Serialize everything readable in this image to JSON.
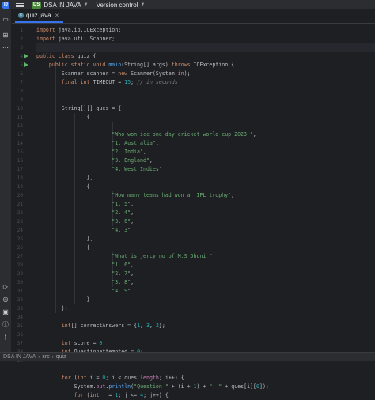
{
  "titlebar": {
    "project_badge": "DS",
    "project_name": "DSA IN JAVA",
    "vcs": "Version control"
  },
  "tab": {
    "label": "quiz.java"
  },
  "statusbar": {
    "breadcrumb": [
      "DSA IN JAVA",
      "src",
      "quiz"
    ]
  },
  "line_numbers": [
    "1",
    "2",
    "3",
    "4",
    "5",
    "6",
    "7",
    "8",
    "9",
    "10",
    "11",
    "12",
    "13",
    "14",
    "15",
    "16",
    "17",
    "18",
    "19",
    "20",
    "21",
    "22",
    "23",
    "24",
    "25",
    "26",
    "27",
    "28",
    "29",
    "30",
    "31",
    "32",
    "33",
    "34",
    "35",
    "36",
    "37",
    "38",
    "39"
  ],
  "colors": {
    "keyword": "#cf8e6d",
    "string": "#6aab73",
    "number": "#2aacb8",
    "comment": "#7a7e85",
    "method": "#56a8f5",
    "field": "#c77dbb",
    "text": "#bcbec4"
  },
  "code_lines": [
    [
      {
        "t": "import ",
        "c": "kw"
      },
      {
        "t": "java.io.IOException;"
      }
    ],
    [
      {
        "t": "import ",
        "c": "kw"
      },
      {
        "t": "java.util.Scanner;"
      }
    ],
    [],
    [
      {
        "t": "public class ",
        "c": "kw"
      },
      {
        "t": "quiz {"
      }
    ],
    [
      {
        "t": "    public static void ",
        "c": "kw"
      },
      {
        "t": "main",
        "c": "fn"
      },
      {
        "t": "(String[] args) "
      },
      {
        "t": "throws ",
        "c": "kw"
      },
      {
        "t": "IOException {"
      }
    ],
    [
      {
        "t": "        Scanner scanner = "
      },
      {
        "t": "new ",
        "c": "kw"
      },
      {
        "t": "Scanner(System."
      },
      {
        "t": "in",
        "c": "fd"
      },
      {
        "t": ");"
      }
    ],
    [
      {
        "t": "        final int ",
        "c": "kw"
      },
      {
        "t": "TIMEOUT = "
      },
      {
        "t": "15",
        "c": "num"
      },
      {
        "t": "; "
      },
      {
        "t": "// in seconds",
        "c": "cm"
      }
    ],
    [],
    [],
    [
      {
        "t": "        String[][] ques = {"
      }
    ],
    [
      {
        "t": "                {"
      }
    ],
    [],
    [
      {
        "t": "                        "
      },
      {
        "t": "\"Who won icc one day cricket world cup 2023 \"",
        "c": "str"
      },
      {
        "t": ","
      }
    ],
    [
      {
        "t": "                        "
      },
      {
        "t": "\"1. Australia\"",
        "c": "str"
      },
      {
        "t": ","
      }
    ],
    [
      {
        "t": "                        "
      },
      {
        "t": "\"2. India\"",
        "c": "str"
      },
      {
        "t": ","
      }
    ],
    [
      {
        "t": "                        "
      },
      {
        "t": "\"3. England\"",
        "c": "str"
      },
      {
        "t": ","
      }
    ],
    [
      {
        "t": "                        "
      },
      {
        "t": "\"4. West Indies\"",
        "c": "str"
      }
    ],
    [
      {
        "t": "                },"
      }
    ],
    [
      {
        "t": "                {"
      }
    ],
    [
      {
        "t": "                        "
      },
      {
        "t": "\"How many teams had won a  IPL trophy\"",
        "c": "str"
      },
      {
        "t": ","
      }
    ],
    [
      {
        "t": "                        "
      },
      {
        "t": "\"1. 5\"",
        "c": "str"
      },
      {
        "t": ","
      }
    ],
    [
      {
        "t": "                        "
      },
      {
        "t": "\"2. 4\"",
        "c": "str"
      },
      {
        "t": ","
      }
    ],
    [
      {
        "t": "                        "
      },
      {
        "t": "\"3. 6\"",
        "c": "str"
      },
      {
        "t": ","
      }
    ],
    [
      {
        "t": "                        "
      },
      {
        "t": "\"4. 3\"",
        "c": "str"
      }
    ],
    [
      {
        "t": "                },"
      }
    ],
    [
      {
        "t": "                {"
      }
    ],
    [
      {
        "t": "                        "
      },
      {
        "t": "\"What is jercy no of M.S Dhoni \"",
        "c": "str"
      },
      {
        "t": ","
      }
    ],
    [
      {
        "t": "                        "
      },
      {
        "t": "\"1. 6\"",
        "c": "str"
      },
      {
        "t": ","
      }
    ],
    [
      {
        "t": "                        "
      },
      {
        "t": "\"2. 7\"",
        "c": "str"
      },
      {
        "t": ","
      }
    ],
    [
      {
        "t": "                        "
      },
      {
        "t": "\"3. 8\"",
        "c": "str"
      },
      {
        "t": ","
      }
    ],
    [
      {
        "t": "                        "
      },
      {
        "t": "\"4. 9\"",
        "c": "str"
      }
    ],
    [
      {
        "t": "                }"
      }
    ],
    [
      {
        "t": "        };"
      }
    ],
    [],
    [
      {
        "t": "        "
      },
      {
        "t": "int",
        "c": "kw"
      },
      {
        "t": "[] correctAnswers = {"
      },
      {
        "t": "1",
        "c": "num"
      },
      {
        "t": ", "
      },
      {
        "t": "3",
        "c": "num"
      },
      {
        "t": ", "
      },
      {
        "t": "2",
        "c": "num"
      },
      {
        "t": "};"
      }
    ],
    [],
    [
      {
        "t": "        "
      },
      {
        "t": "int ",
        "c": "kw"
      },
      {
        "t": "score = "
      },
      {
        "t": "0",
        "c": "num"
      },
      {
        "t": ";"
      }
    ],
    [
      {
        "t": "        "
      },
      {
        "t": "int ",
        "c": "kw"
      },
      {
        "t": "Questionattempted = "
      },
      {
        "t": "0",
        "c": "num"
      },
      {
        "t": ";"
      }
    ],
    [],
    [],
    [
      {
        "t": "        "
      },
      {
        "t": "for ",
        "c": "kw"
      },
      {
        "t": "("
      },
      {
        "t": "int ",
        "c": "kw"
      },
      {
        "t": "i = "
      },
      {
        "t": "0",
        "c": "num"
      },
      {
        "t": "; i < ques."
      },
      {
        "t": "length",
        "c": "fd"
      },
      {
        "t": "; i++) {"
      }
    ],
    [
      {
        "t": "            System."
      },
      {
        "t": "out",
        "c": "fd"
      },
      {
        "t": "."
      },
      {
        "t": "println",
        "c": "fn"
      },
      {
        "t": "("
      },
      {
        "t": "\"Question \"",
        "c": "str"
      },
      {
        "t": " + (i + "
      },
      {
        "t": "1",
        "c": "num"
      },
      {
        "t": ") + "
      },
      {
        "t": "\": \"",
        "c": "str"
      },
      {
        "t": " + ques[i]["
      },
      {
        "t": "0",
        "c": "num"
      },
      {
        "t": "]);"
      }
    ],
    [
      {
        "t": "            "
      },
      {
        "t": "for ",
        "c": "kw"
      },
      {
        "t": "("
      },
      {
        "t": "int ",
        "c": "kw"
      },
      {
        "t": "j = "
      },
      {
        "t": "1",
        "c": "num"
      },
      {
        "t": "; j <= "
      },
      {
        "t": "4",
        "c": "num"
      },
      {
        "t": "; j++) {"
      }
    ]
  ]
}
